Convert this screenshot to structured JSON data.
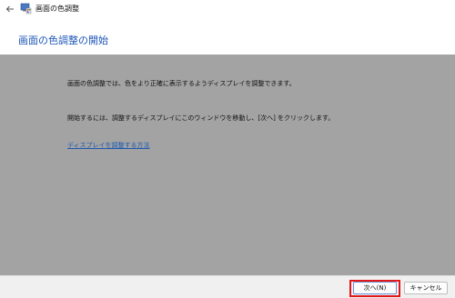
{
  "window": {
    "title": "画面の色調整"
  },
  "header": {
    "heading": "画面の色調整の開始"
  },
  "content": {
    "paragraph1": "画面の色調整では、色をより正確に表示するようディスプレイを調整できます。",
    "paragraph2": "開始するには、調整するディスプレイにこのウィンドウを移動し、[次へ] をクリックします。",
    "help_link": "ディスプレイを調整する方法"
  },
  "footer": {
    "next_label": "次へ(N)",
    "cancel_label": "キャンセル"
  },
  "colors": {
    "heading": "#1d56b8",
    "content_bg": "#a3a3a3",
    "highlight": "#e31919"
  }
}
